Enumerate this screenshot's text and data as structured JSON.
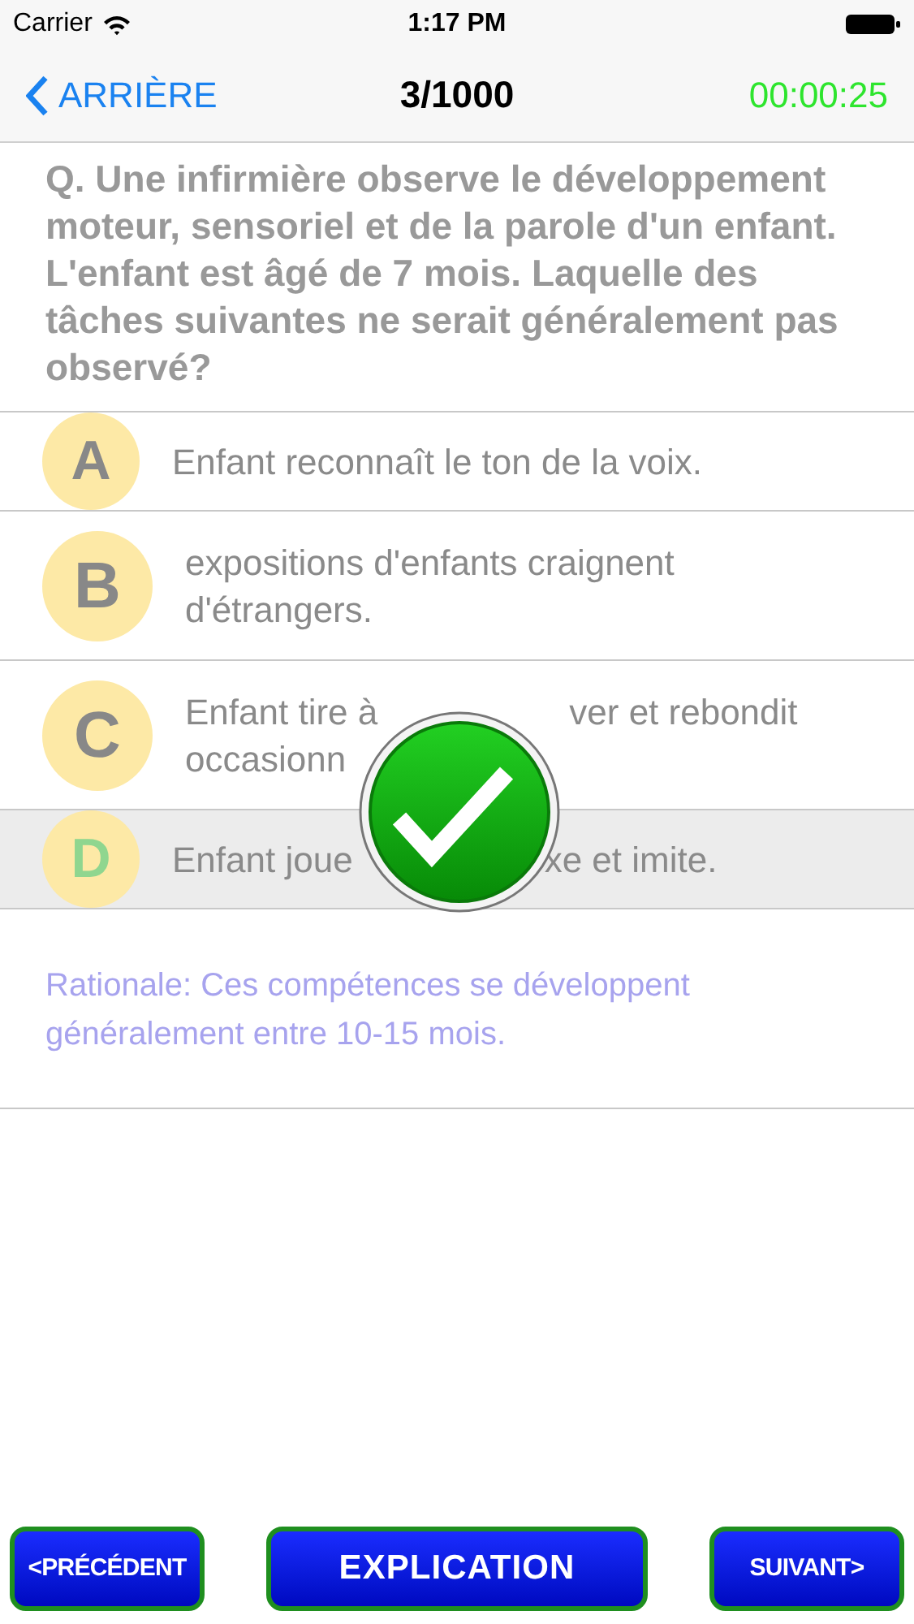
{
  "status_bar": {
    "carrier": "Carrier",
    "time": "1:17 PM"
  },
  "nav": {
    "back": "ARRIÈRE",
    "counter": "3/1000",
    "timer": "00:00:25"
  },
  "question": "Q. Une infirmière observe le développement moteur, sensoriel et de la parole d'un enfant. L'enfant est âgé de 7 mois. Laquelle des tâches suivantes ne serait généralement pas observé?",
  "options": [
    {
      "letter": "A",
      "selected": false,
      "lines": [
        [
          "Enfant reconnaît le ton de la voix."
        ]
      ]
    },
    {
      "letter": "B",
      "selected": false,
      "lines": [
        [
          "expositions d'enfants craignent"
        ],
        [
          "d'étrangers."
        ]
      ]
    },
    {
      "letter": "C",
      "selected": false,
      "lines": [
        [
          "Enfant tire à",
          "ver et rebondit"
        ],
        [
          "occasionn"
        ]
      ]
    },
    {
      "letter": "D",
      "selected": true,
      "lines": [
        [
          "Enfant joue",
          "xe et imite."
        ]
      ]
    }
  ],
  "result": {
    "kind": "correct"
  },
  "rationale": "Rationale: Ces compétences se développent généralement entre 10-15 mois.",
  "buttons": [
    "<PRÉCÉDENT",
    "EXPLICATION",
    "SUIVANT>"
  ]
}
